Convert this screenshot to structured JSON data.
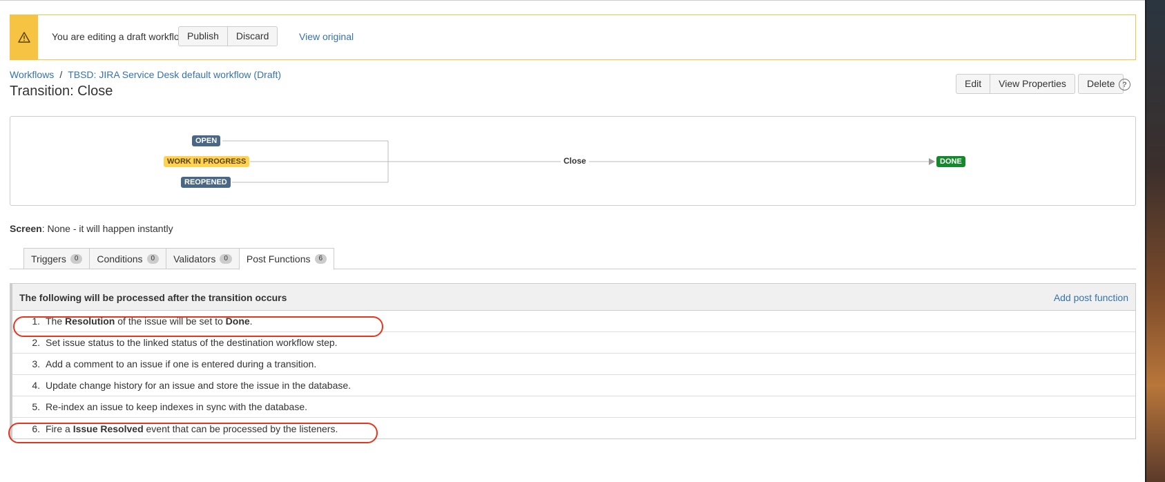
{
  "banner": {
    "message": "You are editing a draft workflow.",
    "publish_label": "Publish",
    "discard_label": "Discard",
    "view_original_label": "View original",
    "icon": "warning-icon",
    "color": "#f6c342"
  },
  "breadcrumb": {
    "workflows_label": "Workflows",
    "separator": "/",
    "workflow_label": "TBSD: JIRA Service Desk default workflow (Draft)"
  },
  "page_title": "Transition: Close",
  "actions": {
    "edit_label": "Edit",
    "view_properties_label": "View Properties",
    "delete_label": "Delete",
    "help_icon": "?"
  },
  "diagram": {
    "from_statuses": [
      "OPEN",
      "WORK IN PROGRESS",
      "REOPENED"
    ],
    "transition_label": "Close",
    "to_status": "DONE"
  },
  "screen": {
    "label": "Screen",
    "value": ": None - it will happen instantly"
  },
  "tabs": [
    {
      "label": "Triggers",
      "count": "0"
    },
    {
      "label": "Conditions",
      "count": "0"
    },
    {
      "label": "Validators",
      "count": "0"
    },
    {
      "label": "Post Functions",
      "count": "6",
      "active": true
    }
  ],
  "post_functions": {
    "header": "The following will be processed after the transition occurs",
    "add_label": "Add post function",
    "items": [
      {
        "num": "1.",
        "pre": "The ",
        "b1": "Resolution",
        "mid": " of the issue will be set to ",
        "b2": "Done",
        "post": "."
      },
      {
        "num": "2.",
        "text": "Set issue status to the linked status of the destination workflow step."
      },
      {
        "num": "3.",
        "text": "Add a comment to an issue if one is entered during a transition."
      },
      {
        "num": "4.",
        "text": "Update change history for an issue and store the issue in the database."
      },
      {
        "num": "5.",
        "text": "Re-index an issue to keep indexes in sync with the database."
      },
      {
        "num": "6.",
        "pre": "Fire a ",
        "b1": "Issue Resolved",
        "post": " event that can be processed by the listeners."
      }
    ]
  },
  "colors": {
    "link": "#3572b0",
    "highlight": "#e8341c",
    "status_blue": "#4a6785",
    "status_yellow": "#ffd351",
    "status_green": "#14892c"
  }
}
